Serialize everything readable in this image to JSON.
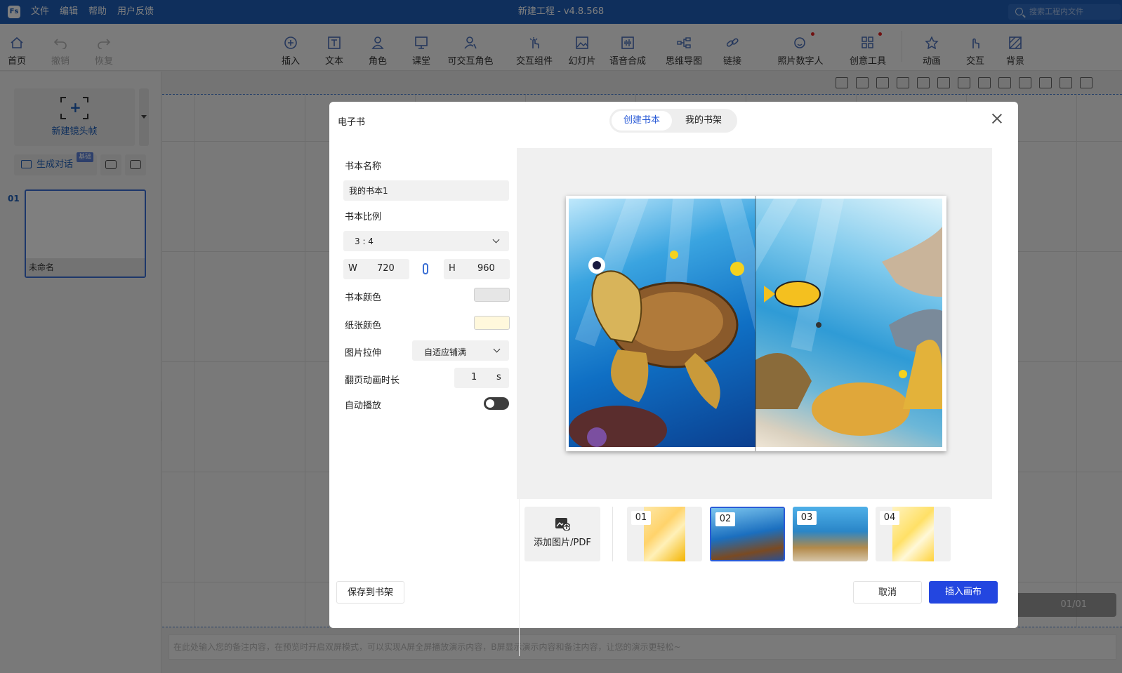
{
  "app": {
    "logo": "Fs",
    "title": "新建工程 - v4.8.568",
    "menu": [
      "文件",
      "编辑",
      "帮助",
      "用户反馈"
    ],
    "search_placeholder": "搜索工程内文件"
  },
  "toolbar": {
    "home": "首页",
    "undo": "撤销",
    "redo": "恢复",
    "insert": "插入",
    "text": "文本",
    "character": "角色",
    "classroom": "课堂",
    "interactive_character": "可交互角色",
    "interactive_component": "交互组件",
    "slides": "幻灯片",
    "tts": "语音合成",
    "mindmap": "思维导图",
    "link": "链接",
    "photo_avatar": "照片数字人",
    "creative_tools": "创意工具",
    "animation": "动画",
    "interaction": "交互",
    "background": "背景"
  },
  "left_panel": {
    "new_shot": "新建镜头帧",
    "generate_dialog": "生成对话",
    "badge": "基础",
    "slide_number": "01",
    "slide_name": "未命名"
  },
  "canvas": {
    "page_indicator": "01/01",
    "notes_placeholder": "在此处输入您的备注内容，在预览时开启双屏模式，可以实现A屏全屏播放演示内容，B屏显示演示内容和备注内容，让您的演示更轻松~"
  },
  "modal": {
    "title": "电子书",
    "tabs": [
      "创建书本",
      "我的书架"
    ],
    "active_tab": 0,
    "book_name_label": "书本名称",
    "book_name_value": "我的书本1",
    "ratio_label": "书本比例",
    "ratio_value": "3 : 4",
    "width_label": "W",
    "width_value": "720",
    "height_label": "H",
    "height_value": "960",
    "book_color_label": "书本颜色",
    "book_color": "#e6e6e6",
    "paper_color_label": "纸张颜色",
    "paper_color": "#fff8dc",
    "stretch_label": "图片拉伸",
    "stretch_value": "自适应铺满",
    "flip_duration_label": "翻页动画时长",
    "flip_duration_value": "1",
    "flip_duration_unit": "s",
    "autoplay_label": "自动播放",
    "autoplay": false,
    "add_image": "添加图片/PDF",
    "thumbnails": [
      "01",
      "02",
      "03",
      "04"
    ],
    "selected_thumbnail": "02",
    "save_shelf": "保存到书架",
    "cancel": "取消",
    "insert_canvas": "插入画布"
  }
}
